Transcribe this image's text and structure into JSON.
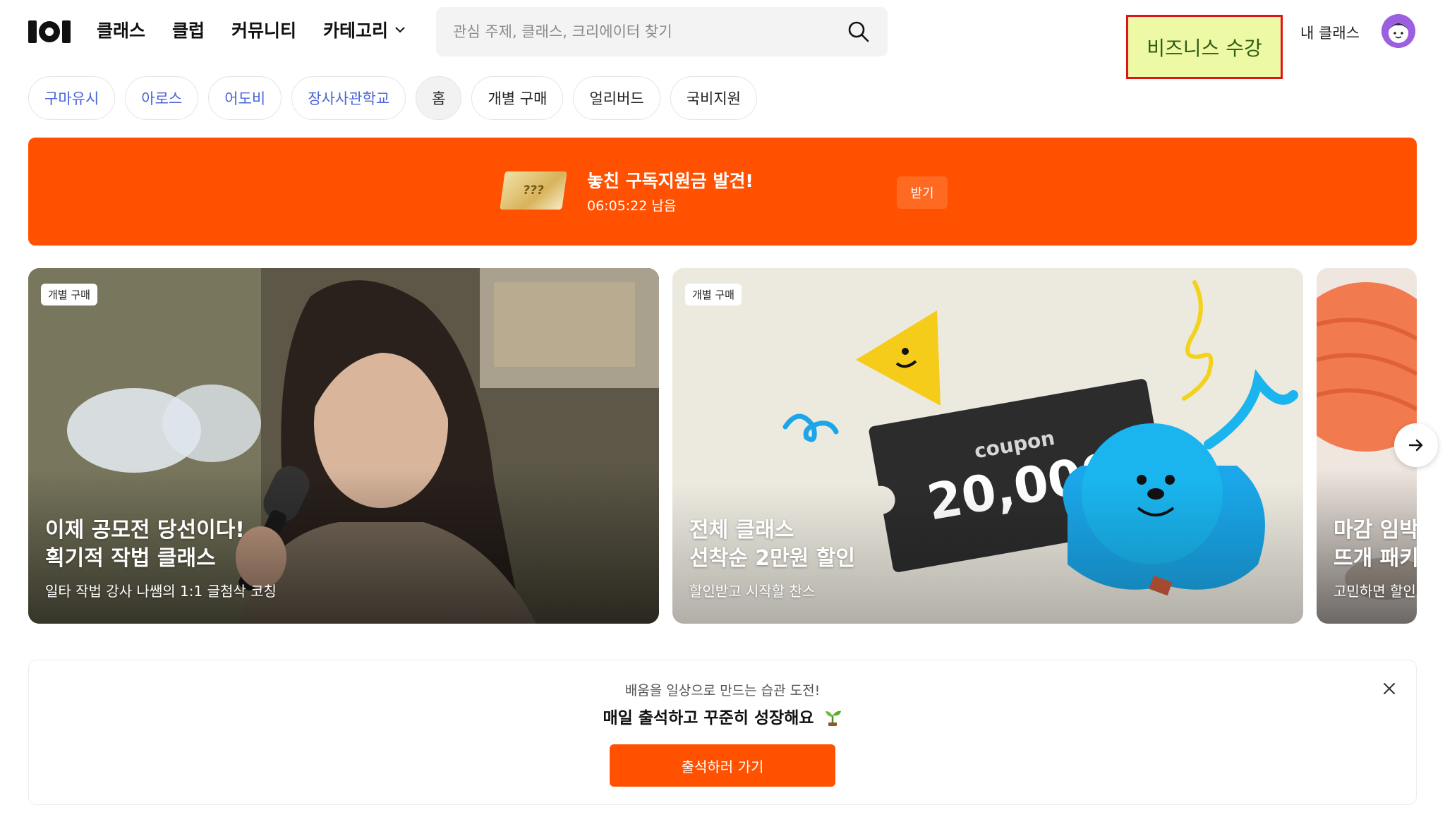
{
  "header": {
    "nav": [
      {
        "label": "클래스"
      },
      {
        "label": "클럽"
      },
      {
        "label": "커뮤니티"
      },
      {
        "label": "카테고리"
      }
    ],
    "search_placeholder": "관심 주제, 클래스, 크리에이터 찾기",
    "business_label": "비즈니스 수강",
    "my_class_label": "내 클래스"
  },
  "chips": [
    {
      "label": "구마유시"
    },
    {
      "label": "아로스"
    },
    {
      "label": "어도비"
    },
    {
      "label": "장사사관학교"
    },
    {
      "label": "홈"
    },
    {
      "label": "개별 구매"
    },
    {
      "label": "얼리버드"
    },
    {
      "label": "국비지원"
    }
  ],
  "banner": {
    "ticket_text": "???",
    "title": "놓친 구독지원금 발견!",
    "time_left": "06:05:22 남음",
    "button": "받기"
  },
  "cards": [
    {
      "badge": "개별 구매",
      "title_line1": "이제 공모전 당선이다!",
      "title_line2": "획기적 작법 클래스",
      "subtitle": "일타 작법 강사 나쌤의 1:1 글첨삭 코칭"
    },
    {
      "badge": "개별 구매",
      "coupon_word": "coupon",
      "coupon_amount": "20,000",
      "title_line1": "전체 클래스",
      "title_line2": "선착순 2만원 할인",
      "subtitle": "할인받고 시작할 찬스"
    },
    {
      "title_line1": "마감 임박",
      "title_line2": "뜨개 패키",
      "subtitle": "고민하면 할인"
    }
  ],
  "attendance": {
    "subtitle": "배움을 일상으로 만드는 습관 도전!",
    "title": "매일 출석하고 꾸준히 성장해요",
    "button": "출석하러 가기"
  },
  "colors": {
    "brand_orange": "#ff5100",
    "link_blue": "#4a64d8",
    "highlight_red": "#e1131a",
    "highlight_yellow": "#eef9a6"
  }
}
